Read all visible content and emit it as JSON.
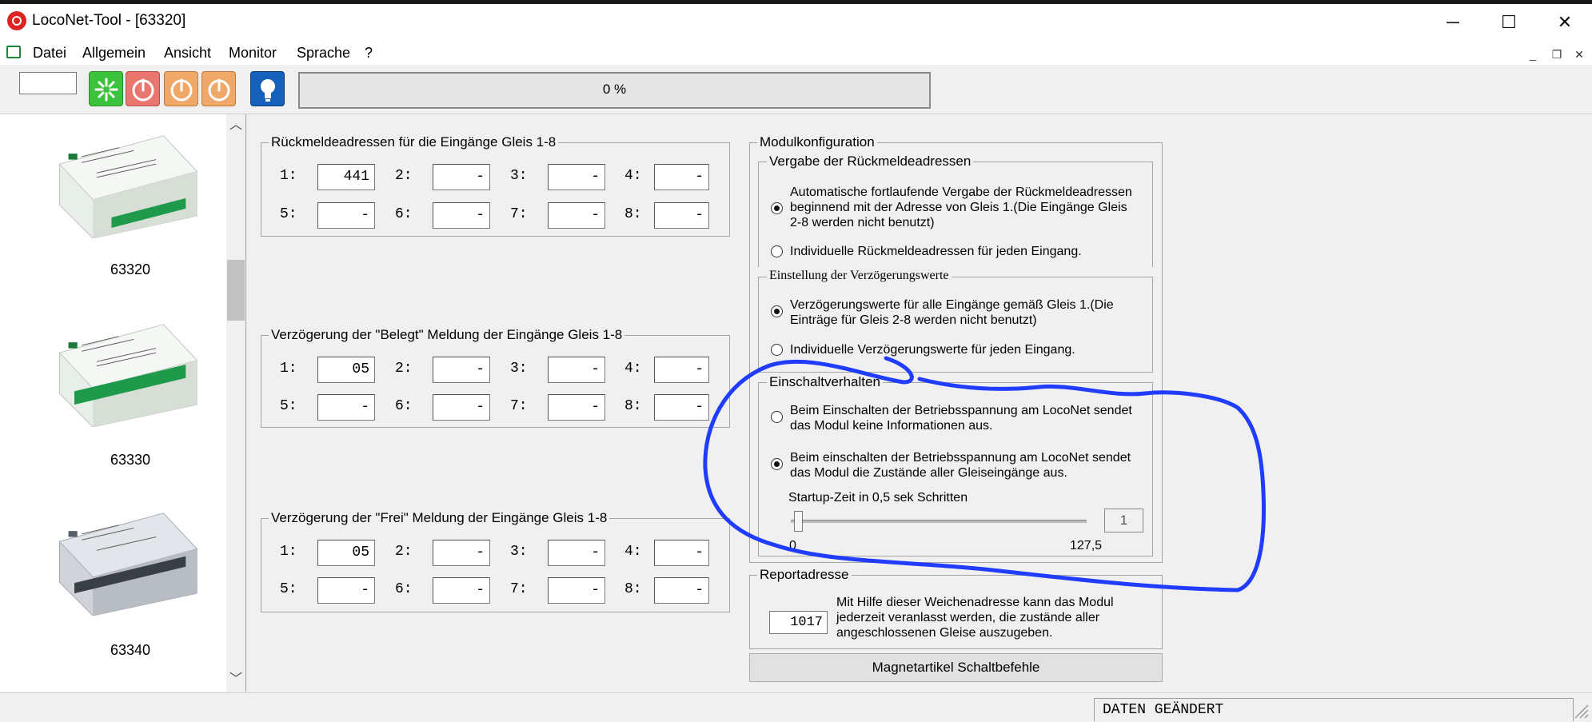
{
  "window": {
    "title": "LocoNet-Tool - [63320]"
  },
  "menu": [
    "Datei",
    "Allgemein",
    "Ansicht",
    "Monitor",
    "Sprache",
    "?"
  ],
  "toolbar": {
    "progress_text": "0 %",
    "progress_value": 0
  },
  "modules": [
    {
      "label": "63320"
    },
    {
      "label": "63330"
    },
    {
      "label": "63340"
    }
  ],
  "rueckmelde": {
    "title": "Rückmeldeadressen für die Eingänge Gleis 1-8",
    "fields": [
      {
        "label": "1:",
        "value": "441"
      },
      {
        "label": "2:",
        "value": "-"
      },
      {
        "label": "3:",
        "value": "-"
      },
      {
        "label": "4:",
        "value": "-"
      },
      {
        "label": "5:",
        "value": "-"
      },
      {
        "label": "6:",
        "value": "-"
      },
      {
        "label": "7:",
        "value": "-"
      },
      {
        "label": "8:",
        "value": "-"
      }
    ]
  },
  "belegt": {
    "title": "Verzögerung der \"Belegt\" Meldung der Eingänge Gleis 1-8",
    "fields": [
      {
        "label": "1:",
        "value": "05"
      },
      {
        "label": "2:",
        "value": "-"
      },
      {
        "label": "3:",
        "value": "-"
      },
      {
        "label": "4:",
        "value": "-"
      },
      {
        "label": "5:",
        "value": "-"
      },
      {
        "label": "6:",
        "value": "-"
      },
      {
        "label": "7:",
        "value": "-"
      },
      {
        "label": "8:",
        "value": "-"
      }
    ]
  },
  "frei": {
    "title": "Verzögerung der \"Frei\" Meldung der Eingänge Gleis 1-8",
    "fields": [
      {
        "label": "1:",
        "value": "05"
      },
      {
        "label": "2:",
        "value": "-"
      },
      {
        "label": "3:",
        "value": "-"
      },
      {
        "label": "4:",
        "value": "-"
      },
      {
        "label": "5:",
        "value": "-"
      },
      {
        "label": "6:",
        "value": "-"
      },
      {
        "label": "7:",
        "value": "-"
      },
      {
        "label": "8:",
        "value": "-"
      }
    ]
  },
  "modulkonfig": {
    "title": "Modulkonfiguration",
    "vergabe": {
      "title": "Vergabe der Rückmeldeadressen",
      "opt1": [
        "Automatische fortlaufende Vergabe der Rückmeldeadressen",
        "beginnend mit der Adresse von Gleis 1.(Die Eingänge Gleis",
        "2-8 werden nicht benutzt)"
      ],
      "opt2": "Individuelle Rückmeldeadressen für jeden Eingang.",
      "selected": 1
    },
    "verzoegerung": {
      "title": "Einstellung der Verzögerungswerte",
      "opt1": [
        "Verzögerungswerte für alle Eingänge gemäß Gleis 1.(Die",
        "Einträge für Gleis 2-8 werden nicht benutzt)"
      ],
      "opt2": "Individuelle Verzögerungswerte für jeden Eingang.",
      "selected": 1
    },
    "einschalt": {
      "title": "Einschaltverhalten",
      "opt1": [
        "Beim Einschalten der Betriebsspannung am LocoNet sendet",
        "das Modul keine Informationen aus."
      ],
      "opt2": [
        "Beim einschalten der Betriebsspannung am LocoNet sendet",
        "das Modul die Zustände aller Gleiseingänge aus."
      ],
      "selected": 2,
      "startup_label": "Startup-Zeit in 0,5 sek Schritten",
      "slider_min": "0",
      "slider_max": "127,5",
      "slider_value": "1"
    }
  },
  "report": {
    "title": "Reportadresse",
    "value": "1017",
    "text": [
      "Mit Hilfe dieser Weichenadresse kann das Modul",
      "jederzeit veranlasst werden, die zustände aller",
      "angeschlossenen Gleise auszugeben."
    ]
  },
  "magnet_button": "Magnetartikel Schaltbefehle",
  "status": "DATEN GEÄNDERT",
  "colors": {
    "accent": "#3a8ee6",
    "annotation": "#1f3cff",
    "start_green": "#3cc23c",
    "stop_red": "#e9776f",
    "off_orange": "#f0a868",
    "light_blue": "#1560b8"
  }
}
